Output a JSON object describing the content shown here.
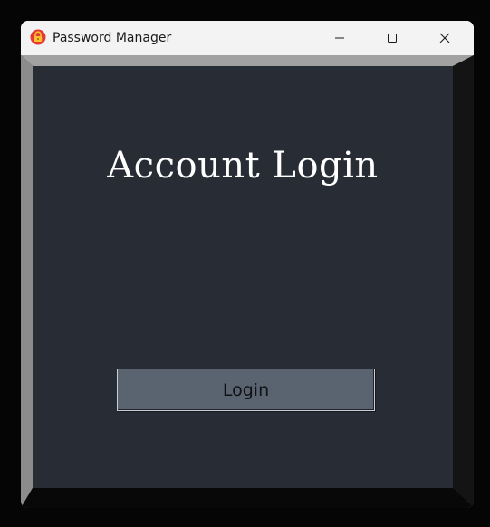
{
  "window": {
    "title": "Password Manager",
    "app_icon": "padlock-icon",
    "controls": {
      "minimize_icon": "minimize-icon",
      "maximize_icon": "maximize-icon",
      "close_icon": "close-icon"
    }
  },
  "main": {
    "heading": "Account Login",
    "login_button_label": "Login"
  },
  "colors": {
    "panel_background": "#272c35",
    "button_background": "#5a6470",
    "heading_text": "#ffffff",
    "app_icon_red": "#e53935"
  }
}
